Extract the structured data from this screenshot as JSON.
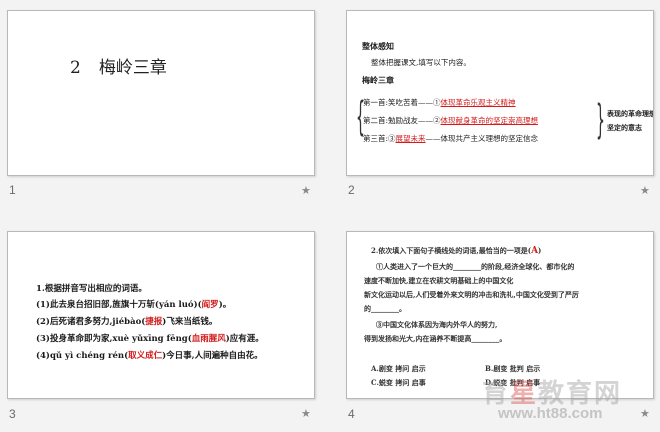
{
  "slides": [
    {
      "number": "1",
      "title_num": "2",
      "title_text": "梅岭三章"
    },
    {
      "number": "2",
      "heading": "整体感知",
      "instruction": "整体把握课文,填写以下内容。",
      "poem_title": "梅岭三章",
      "rows": [
        {
          "label": "第一首:笑吃苦着——①",
          "answer": "体现革命乐观主义精神"
        },
        {
          "label": "第二首:勉励战友——②",
          "answer": "体现献身革命的坚定崇高理想"
        },
        {
          "label": "第三首:③",
          "answer": "展望未来",
          "tail": "——体现共产主义理想的坚定信念"
        }
      ],
      "summary_1": "表现的革命理想",
      "summary_2": "坚定的意志"
    },
    {
      "number": "3",
      "q_title": "1.根据拼音写出相应的词语。",
      "items": [
        {
          "pre": "(1)此去泉台招旧部,旌旗十万斩(yán luó)",
          "ans": "阎罗",
          "post": "。"
        },
        {
          "pre": "(2)后死诸君多努力,jiébào(",
          "ans": "捷报",
          "post": ")飞来当纸钱。"
        },
        {
          "pre": "(3)投身革命即为家,xuè yǔxīng fēng(",
          "ans": "血雨腥风",
          "post": ")应有涯。"
        },
        {
          "pre": "(4)qǔ yì chéng rén(",
          "ans": "取义成仁",
          "post": ")今日事,人间遍种自由花。"
        }
      ]
    },
    {
      "number": "4",
      "q_title": "2.依次填入下面句子横线处的词语,最恰当的一项是(",
      "q_ans": "A",
      "q_end": ")",
      "p1a": "①人类进入了一个巨大的________的阶段,经济全球化、都市化的",
      "p1b": "速度不断加快,建立在农耕文明基础上的中国文化",
      "p2a": "的________。",
      "p2b": "新文化运动以后,人们受着外来文明的冲击和洗礼,中国文化受到了严厉",
      "p3a": "③中国文化体系因为海内外华人的努力,",
      "p3b": "得到发扬和光大,内在涵养不断提高________。",
      "options": [
        {
          "l": "A.剧变   拷问   启示",
          "r": "B.剧变   批判   启示"
        },
        {
          "l": "C.蜕变   拷问   启事",
          "r": "D.蜕变   批判   启事"
        }
      ]
    }
  ],
  "watermark": {
    "brand_a": "育",
    "brand_b": "星",
    "brand_c": "教育网",
    "url": "www.ht88.com"
  },
  "star_glyph": "★"
}
